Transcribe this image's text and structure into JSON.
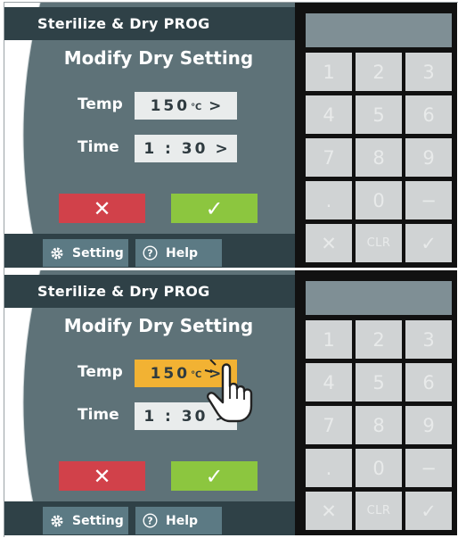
{
  "panels": [
    {
      "title": "Sterilize & Dry PROG",
      "heading": "Modify Dry Setting",
      "temp_label": "Temp",
      "temp_value": "150",
      "temp_unit": "℃",
      "time_label": "Time",
      "time_value": "1 : 30",
      "chevron": ">",
      "cancel_glyph": "✕",
      "ok_glyph": "✓",
      "setting_label": "Setting",
      "help_label": "Help",
      "temp_highlighted": false
    },
    {
      "title": "Sterilize & Dry PROG",
      "heading": "Modify Dry Setting",
      "temp_label": "Temp",
      "temp_value": "150",
      "temp_unit": "℃",
      "time_label": "Time",
      "time_value": "1 : 30",
      "chevron": ">",
      "cancel_glyph": "✕",
      "ok_glyph": "✓",
      "setting_label": "Setting",
      "help_label": "Help",
      "temp_highlighted": true
    }
  ],
  "keypad": {
    "keys": [
      "1",
      "2",
      "3",
      "4",
      "5",
      "6",
      "7",
      "8",
      "9",
      ".",
      "0",
      "−",
      "✕",
      "CLR",
      "✓"
    ]
  },
  "colors": {
    "panel": "#5e7278",
    "bar": "#2f4147",
    "highlight": "#f2b233",
    "cancel": "#d1414a",
    "ok": "#8cc63f"
  },
  "icons": [
    "gear-icon",
    "help-icon",
    "hand-pointer-icon"
  ]
}
